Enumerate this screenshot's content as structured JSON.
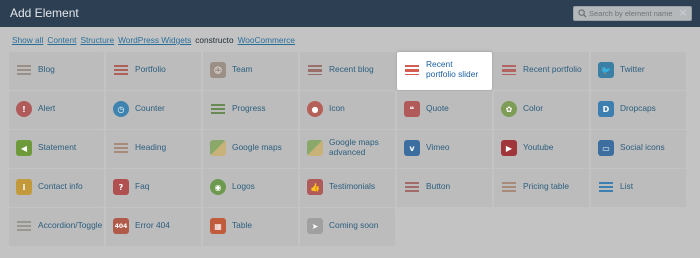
{
  "dialog": {
    "title": "Add Element",
    "search_placeholder": "Search by element name",
    "close_glyph": "×"
  },
  "tabs": [
    {
      "label": "Show all",
      "active": false
    },
    {
      "label": "Content",
      "active": false
    },
    {
      "label": "Structure",
      "active": false
    },
    {
      "label": "WordPress Widgets",
      "active": false
    },
    {
      "label": "constructo",
      "active": true
    },
    {
      "label": "WooCommerce",
      "active": false
    }
  ],
  "elements": [
    {
      "label": "Blog",
      "icon": "blog-icon",
      "color": "#9a8f86"
    },
    {
      "label": "Portfolio",
      "icon": "portfolio-icon",
      "color": "#b06157"
    },
    {
      "label": "Team",
      "icon": "team-icon",
      "color": "#9c8f86"
    },
    {
      "label": "Recent blog",
      "icon": "recent-blog-icon",
      "color": "#9a6e69"
    },
    {
      "label": "Recent portfolio slider",
      "icon": "recent-portfolio-slider-icon",
      "color": "#d45c55"
    },
    {
      "label": "Recent portfolio",
      "icon": "recent-portfolio-icon",
      "color": "#b36460"
    },
    {
      "label": "Twitter",
      "icon": "twitter-icon",
      "color": "#3c7fa5"
    },
    {
      "label": "Alert",
      "icon": "alert-icon",
      "color": "#b05a5a"
    },
    {
      "label": "Counter",
      "icon": "counter-icon",
      "color": "#3f84b0"
    },
    {
      "label": "Progress",
      "icon": "progress-icon",
      "color": "#6a8a55"
    },
    {
      "label": "Icon",
      "icon": "icon-icon",
      "color": "#b56058"
    },
    {
      "label": "Quote",
      "icon": "quote-icon",
      "color": "#b05a5a"
    },
    {
      "label": "Color",
      "icon": "color-icon",
      "color": "#7d9c55"
    },
    {
      "label": "Dropcaps",
      "icon": "dropcaps-icon",
      "color": "#3c7fb0"
    },
    {
      "label": "Statement",
      "icon": "statement-icon",
      "color": "#6e9a3c"
    },
    {
      "label": "Heading",
      "icon": "heading-icon",
      "color": "#a88a7a"
    },
    {
      "label": "Google maps",
      "icon": "google-maps-icon",
      "color": "#7f9a68"
    },
    {
      "label": "Google maps advanced",
      "icon": "google-maps-advanced-icon",
      "color": "#7f9a68"
    },
    {
      "label": "Vimeo",
      "icon": "vimeo-icon",
      "color": "#3c6fa0"
    },
    {
      "label": "Youtube",
      "icon": "youtube-icon",
      "color": "#a0353a"
    },
    {
      "label": "Social icons",
      "icon": "social-icons-icon",
      "color": "#3c6fa0"
    },
    {
      "label": "Contact info",
      "icon": "contact-info-icon",
      "color": "#c29a3c"
    },
    {
      "label": "Faq",
      "icon": "faq-icon",
      "color": "#b05050"
    },
    {
      "label": "Logos",
      "icon": "logos-icon",
      "color": "#6e9a50"
    },
    {
      "label": "Testimonials",
      "icon": "testimonials-icon",
      "color": "#b05a5a"
    },
    {
      "label": "Button",
      "icon": "button-icon",
      "color": "#a36a6a"
    },
    {
      "label": "Pricing table",
      "icon": "pricing-table-icon",
      "color": "#a88a7a"
    },
    {
      "label": "List",
      "icon": "list-icon",
      "color": "#3c7fb0"
    },
    {
      "label": "Accordion/Toggle",
      "icon": "accordion-toggle-icon",
      "color": "#9a9690"
    },
    {
      "label": "Error 404",
      "icon": "error-404-icon",
      "color": "#b05a4a"
    },
    {
      "label": "Table",
      "icon": "table-icon",
      "color": "#c05c3c"
    },
    {
      "label": "Coming soon",
      "icon": "coming-soon-icon",
      "color": "#a0a0a0"
    }
  ]
}
